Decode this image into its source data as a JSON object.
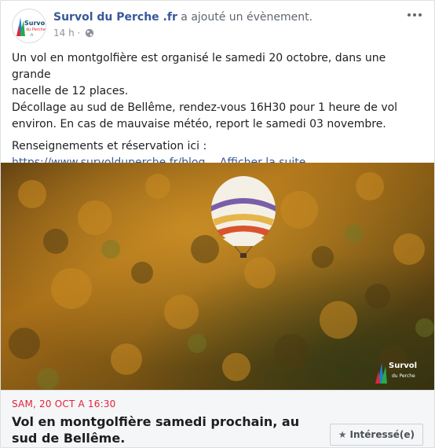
{
  "post": {
    "page_name": "Survol du Perche .fr",
    "action": " a ajouté un évènement.",
    "time": "14 h · ",
    "privacy_icon": "globe-icon",
    "more_icon": "more-options-icon",
    "avatar_logo": {
      "line1": "Survol",
      "line2": "du Perche",
      "line3": ".fr"
    }
  },
  "body": {
    "p1_line1": "Un vol en montgolfière est organisé le samedi 20 octobre, dans une grande",
    "p1_line2": "nacelle de 12 places.",
    "p1_line3": "Décollage au sud de Bellême, rendez-vous 16H30 pour 1 heure de vol",
    "p1_line4": "environ. En cas de mauvaise météo, report le samedi 03 novembre.",
    "p2_line1": "Renseignements et réservation ici :",
    "link": "https://www.survolduperche.fr/blog…",
    "see_more": "Afficher la suite"
  },
  "photo": {
    "watermark_line1": "Survol",
    "watermark_line2": "du Perche"
  },
  "event": {
    "date": "SAM, 20 OCT A 16:30",
    "title": "Vol en montgolfière samedi prochain, au sud de Bellême.",
    "interested_label": "Intéressé(e)",
    "interested_icon": "star-icon"
  },
  "colors": {
    "link": "#385898",
    "event_date": "#e2233c",
    "muted": "#90949c"
  }
}
